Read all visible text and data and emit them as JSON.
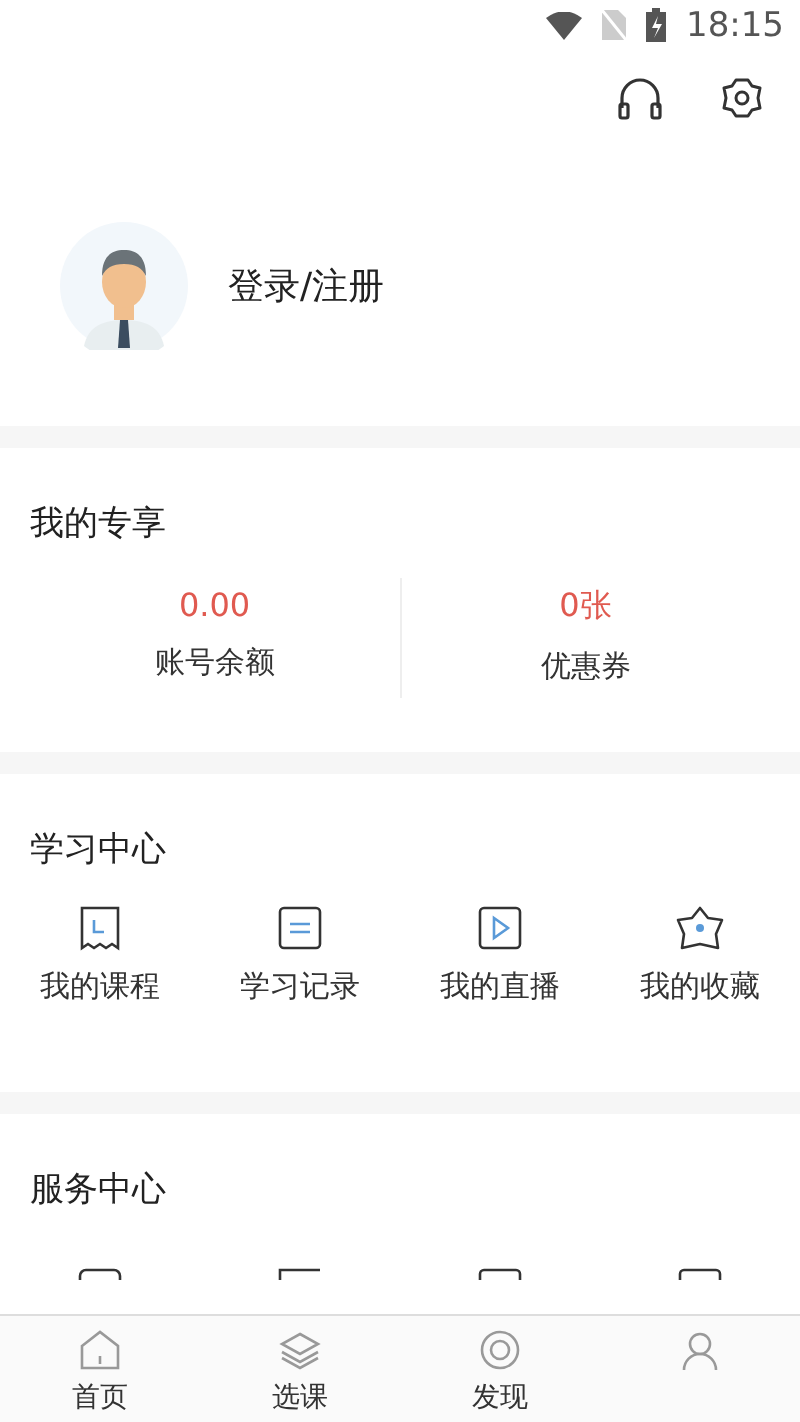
{
  "status_bar": {
    "time": "18:15"
  },
  "profile": {
    "login_label": "登录/注册"
  },
  "exclusive": {
    "title": "我的专享",
    "stats": [
      {
        "value": "0.00",
        "label": "账号余额"
      },
      {
        "value": "0张",
        "label": "优惠券"
      }
    ]
  },
  "study_center": {
    "title": "学习中心",
    "items": [
      {
        "kind": "course",
        "label": "我的课程"
      },
      {
        "kind": "record",
        "label": "学习记录"
      },
      {
        "kind": "live",
        "label": "我的直播"
      },
      {
        "kind": "favorite",
        "label": "我的收藏"
      }
    ]
  },
  "service_center": {
    "title": "服务中心",
    "items": [
      {
        "kind": "a"
      },
      {
        "kind": "b"
      },
      {
        "kind": "c"
      },
      {
        "kind": "d"
      }
    ]
  },
  "tab_bar": [
    {
      "kind": "home",
      "label": "首页"
    },
    {
      "kind": "layers",
      "label": "选课"
    },
    {
      "kind": "discover",
      "label": "发现"
    },
    {
      "kind": "profile"
    }
  ]
}
